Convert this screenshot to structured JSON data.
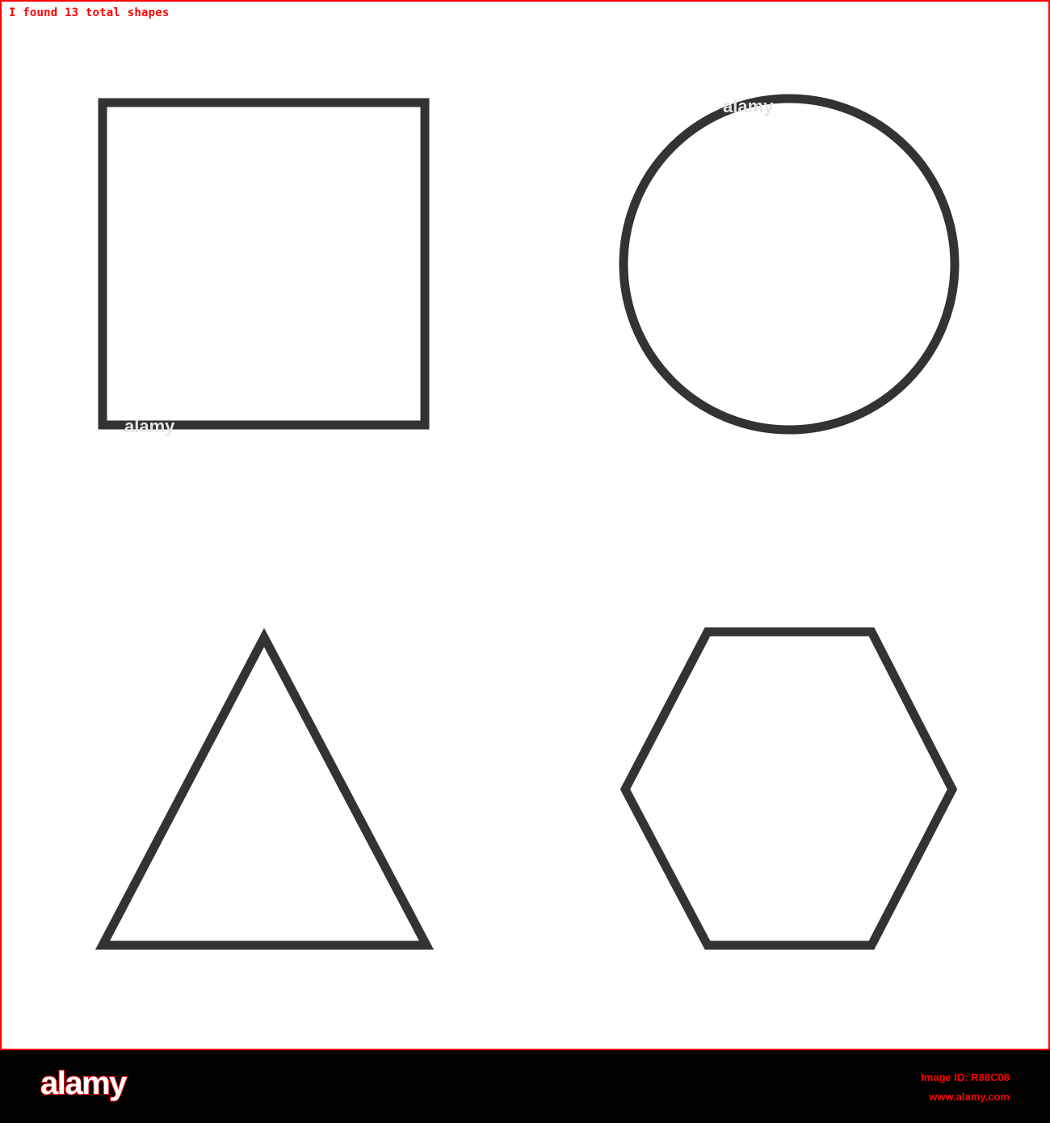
{
  "detection": {
    "caption": "I found 13 total shapes",
    "caption_color": "#ff0000",
    "border_color": "#ff0000"
  },
  "shapes": [
    {
      "kind": "square-icon"
    },
    {
      "kind": "circle-icon"
    },
    {
      "kind": "triangle-icon"
    },
    {
      "kind": "hexagon-icon"
    }
  ],
  "colors": {
    "stroke": "#333333",
    "background": "#ffffff",
    "footer_background": "#000000"
  },
  "watermark": {
    "text": "alamy"
  },
  "footer": {
    "logo": "alamy",
    "image_id": "Image ID: R88C08",
    "url": "www.alamy.com"
  }
}
